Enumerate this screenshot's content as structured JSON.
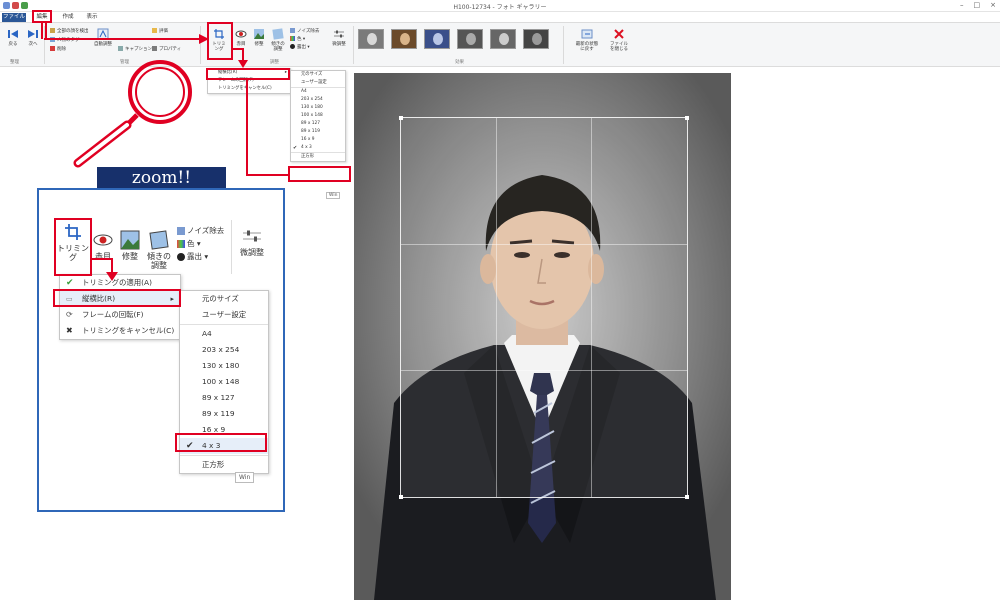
{
  "window": {
    "title": "H100-12734 - フォト ギャラリー"
  },
  "tabs": {
    "file": "ファイル",
    "edit": "編集",
    "create": "作成",
    "view": "表示"
  },
  "ribbon": {
    "groups": {
      "organize": "整理",
      "manage": "管理",
      "adjust": "調整",
      "effects": "効果"
    },
    "buttons": {
      "back": "戻る",
      "next": "次へ",
      "tag_label": "人物のタグ",
      "find_people": "全部の顔を検出",
      "delete": "削除",
      "auto_adjust": "自動調整",
      "caption": "キャプション",
      "properties": "プロパティ",
      "rating": "評価",
      "crop_line1": "トリミ",
      "crop_line2": "ング",
      "red_eye": "赤目",
      "retouch": "修整",
      "straighten_line1": "傾きの",
      "straighten_line2": "調整",
      "noise": "ノイズ除去",
      "color": "色",
      "exposure": "露出",
      "fine_tune": "微調整",
      "preview_line1": "最新の状態",
      "preview_line2": "に戻す",
      "close_line1": "ファイル",
      "close_line2": "を閉じる"
    }
  },
  "crop_menu_small": {
    "items": [
      "縦横比(R)",
      "フレームの回転(F)",
      "トリミングをキャンセル(C)"
    ]
  },
  "ratio_menu_small": {
    "items": [
      "元のサイズ",
      "ユーザー設定",
      "A4",
      "203 x 254",
      "130 x 180",
      "100 x 148",
      "89 x 127",
      "89 x 119",
      "16 x 9",
      "4 x 3",
      "正方形"
    ],
    "checked_index": 9,
    "extra": "Win"
  },
  "zoom": {
    "title": "zoom!!",
    "crop_button": "トリミング",
    "red_eye": "赤目",
    "retouch": "修整",
    "straighten_line1": "傾きの",
    "straighten_line2": "調整",
    "noise": "ノイズ除去",
    "color": "色",
    "exposure": "露出",
    "fine_tune": "微調整",
    "crop_menu": {
      "apply": "トリミングの適用(A)",
      "ratio": "縦横比(R)",
      "rotate": "フレームの回転(F)",
      "cancel": "トリミングをキャンセル(C)"
    },
    "ratio_menu": {
      "items": [
        "元のサイズ",
        "ユーザー設定",
        "A4",
        "203 x 254",
        "130 x 180",
        "100 x 148",
        "89 x 127",
        "89 x 119",
        "16 x 9",
        "4 x 3",
        "正方形"
      ],
      "checked_index": 9,
      "tooltip": "Win"
    }
  },
  "colors": {
    "highlight": "#e00022",
    "zoom_border": "#2f67b8",
    "zoom_title_bg": "#17306b",
    "file_tab": "#2b5797"
  }
}
